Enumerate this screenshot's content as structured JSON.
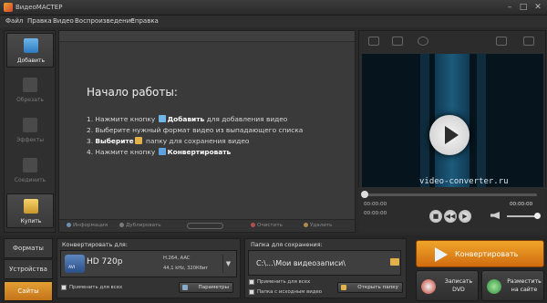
{
  "window": {
    "title": "ВидеоМАСТЕР"
  },
  "menu": [
    "Файл",
    "Правка",
    "Видео",
    "Воспроизведение",
    "Справка"
  ],
  "sidebar": [
    {
      "label": "Добавить",
      "icon": "add-video-icon",
      "active": true
    },
    {
      "label": "Обрезать",
      "icon": "crop-icon",
      "active": false
    },
    {
      "label": "Эффекты",
      "icon": "effects-icon",
      "active": false
    },
    {
      "label": "Соединить",
      "icon": "join-icon",
      "active": false
    },
    {
      "label": "Купить",
      "icon": "buy-icon",
      "active": true
    }
  ],
  "start": {
    "title": "Начало работы:",
    "step1_pre": "1. Нажмите кнопку",
    "step1_bold": "Добавить",
    "step1_post": "для добавления видео",
    "step2": "2. Выберите нужный формат видео из выпадающего списка",
    "step3_pre": "3.",
    "step3_bold": "Выберите",
    "step3_post": "папку для сохранения видео",
    "step4_pre": "4. Нажмите кнопку",
    "step4_bold": "Конвертировать"
  },
  "list_tools": {
    "info": "Информация",
    "duplicate": "Дублировать",
    "clear": "Очистить",
    "delete": "Удалить"
  },
  "player": {
    "watermark": "video-converter.ru",
    "time_left_top": "00:00:00",
    "time_left_bottom": "00:00:00",
    "time_right_top": "00:00:00",
    "time_right_bottom": "00:00:00"
  },
  "tabs": [
    "Форматы",
    "Устройства",
    "Сайты"
  ],
  "convert_for": {
    "label": "Конвертировать для:",
    "format": "HD 720p",
    "badge": "AVI",
    "spec1": "H.264, AAC",
    "spec2": "44,1 kHz, 320Кбит",
    "apply_all": "Применить для всех",
    "params": "Параметры"
  },
  "save_folder": {
    "label": "Папка для сохранения:",
    "path": "C:\\...\\Мои видеозаписи\\",
    "apply_all": "Применить для всех",
    "source_folder": "Папка с исходным видео",
    "open_folder": "Открыть папку"
  },
  "actions": {
    "convert": "Конвертировать",
    "burn_dvd": "Записать DVD",
    "publish": "Разместить на сайте"
  },
  "colors": {
    "accent": "#e08a22",
    "video_bg": "#05141d"
  }
}
